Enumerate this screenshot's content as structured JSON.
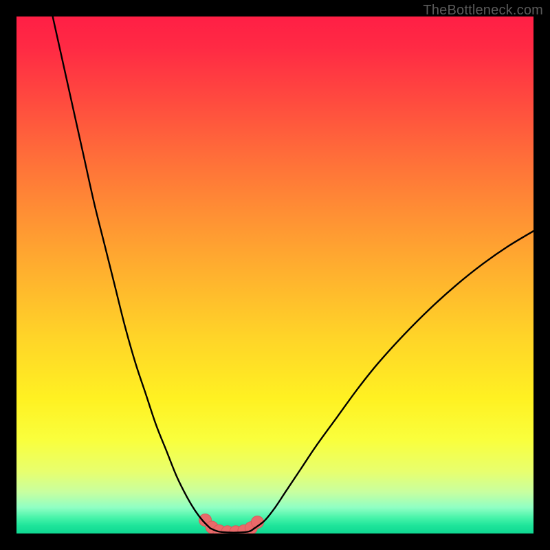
{
  "watermark": {
    "text": "TheBottleneck.com"
  },
  "colors": {
    "frame": "#000000",
    "curve": "#000000",
    "marker": "#e96a6a",
    "marker_stroke": "#d85a5a"
  },
  "chart_data": {
    "type": "line",
    "title": "",
    "xlabel": "",
    "ylabel": "",
    "xlim": [
      0,
      100
    ],
    "ylim": [
      0,
      100
    ],
    "grid": false,
    "series": [
      {
        "name": "left-curve",
        "x": [
          7,
          9,
          11,
          13,
          15,
          17,
          19,
          21,
          23,
          25,
          27,
          29,
          31,
          33,
          34.5,
          36,
          37.5
        ],
        "y": [
          100,
          91,
          82,
          73,
          64,
          56,
          48,
          40,
          33,
          27,
          21,
          16,
          11,
          7,
          4.5,
          2.5,
          1
        ]
      },
      {
        "name": "right-curve",
        "x": [
          46,
          48,
          50,
          52,
          55,
          58,
          62,
          66,
          70,
          75,
          80,
          85,
          90,
          95,
          100
        ],
        "y": [
          1,
          2.5,
          5,
          8,
          12.5,
          17,
          22.5,
          28,
          33,
          38.5,
          43.5,
          48,
          52,
          55.5,
          58.5
        ]
      },
      {
        "name": "valley-floor",
        "x": [
          37.5,
          39,
          41,
          43,
          45,
          46
        ],
        "y": [
          1,
          0.4,
          0.2,
          0.2,
          0.4,
          1
        ]
      }
    ],
    "markers": {
      "name": "valley-markers",
      "points": [
        {
          "x": 36.5,
          "y": 2.6
        },
        {
          "x": 37.8,
          "y": 1.2
        },
        {
          "x": 39.2,
          "y": 0.5
        },
        {
          "x": 40.8,
          "y": 0.3
        },
        {
          "x": 42.4,
          "y": 0.3
        },
        {
          "x": 44.0,
          "y": 0.5
        },
        {
          "x": 45.4,
          "y": 1.1
        },
        {
          "x": 46.6,
          "y": 2.2
        }
      ],
      "radius": 9
    }
  }
}
